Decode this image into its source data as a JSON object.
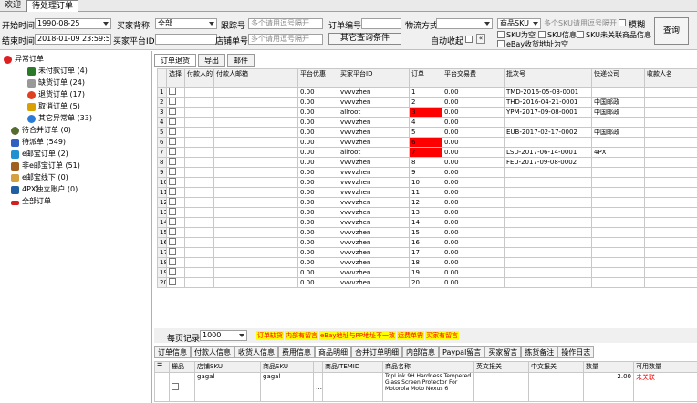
{
  "tabs": [
    "欢迎",
    "待处理订单"
  ],
  "filters": {
    "start_label": "开始时间",
    "start_value": "1990-08-25",
    "end_label": "结束时间",
    "end_value": "2018-01-09 23:59:5",
    "buyer_label": "买家背称",
    "buyer_value": "全部",
    "buyer_platform_label": "买家平台ID",
    "tracking_label": "跟踪号",
    "tracking_ph": "多个请用逗号隔开",
    "order_no_label": "订单编号",
    "logistics_label": "物流方式",
    "product_sku_select": "商品SKU",
    "sku_ph": "多个SKU请用逗号隔开",
    "fuzzy_label": "模糊",
    "store_label": "店铺单号",
    "store_ph": "多个请用逗号隔开",
    "other_query": "其它查询条件",
    "auto_collapse": "自动收起",
    "sku_empty": "SKU为空",
    "sku_multi": "SKU信息",
    "sku_unlinked": "SKU未关联商品信息",
    "ebay_addr": "eBay收货地址为空",
    "query_button": "查询"
  },
  "tree": [
    {
      "label": "异常订单",
      "color": "#e02020"
    },
    {
      "label": "未付款订单 (4)",
      "color": "#2a7a2a"
    },
    {
      "label": "缺货订单 (24)",
      "color": "#999999"
    },
    {
      "label": "退货订单 (17)",
      "color": "#e04020"
    },
    {
      "label": "取消订单 (5)",
      "color": "#d8a000"
    },
    {
      "label": "其它异常单 (33)",
      "color": "#2a7ad8"
    },
    {
      "label": "待合并订单 (0)",
      "color": "#556b2f"
    },
    {
      "label": "待派单 (549)",
      "color": "#3060c0"
    },
    {
      "label": "e邮宝订单 (2)",
      "color": "#2090d0"
    },
    {
      "label": "非e邮宝订单 (51)",
      "color": "#a06020"
    },
    {
      "label": "e邮宝线下 (0)",
      "color": "#d4a040"
    },
    {
      "label": "4PX独立账户 (0)",
      "color": "#2060a0"
    },
    {
      "label": "全部订单",
      "color": "#d02020"
    }
  ],
  "subtabs": [
    "订单退货",
    "导出",
    "邮件"
  ],
  "columns": [
    "选择",
    "付款人的",
    "付款人邮箱",
    "平台优惠",
    "买家平台ID",
    "订单",
    "平台交易费",
    "批次号",
    "快递公司",
    "收款人名"
  ],
  "rows": [
    {
      "n": "1",
      "disc": "0.00",
      "buyer": "vvvvzhen",
      "ord": "1",
      "fee": "0.00",
      "batch": "TMD-2016-05-03-0001",
      "exp": "",
      "red": false
    },
    {
      "n": "2",
      "disc": "0.00",
      "buyer": "vvvvzhen",
      "ord": "2",
      "fee": "0.00",
      "batch": "THD-2016-04-21-0001",
      "exp": "中国邮政",
      "red": false
    },
    {
      "n": "3",
      "disc": "0.00",
      "buyer": "allroot",
      "ord": "3",
      "fee": "0.00",
      "batch": "YPM-2017-09-08-0001",
      "exp": "中国邮政",
      "red": true
    },
    {
      "n": "4",
      "disc": "0.00",
      "buyer": "vvvvzhen",
      "ord": "4",
      "fee": "0.00",
      "batch": "",
      "exp": "",
      "red": false
    },
    {
      "n": "5",
      "disc": "0.00",
      "buyer": "vvvvzhen",
      "ord": "5",
      "fee": "0.00",
      "batch": "EUB-2017-02-17-0002",
      "exp": "中国邮政",
      "red": false
    },
    {
      "n": "6",
      "disc": "0.00",
      "buyer": "vvvvzhen",
      "ord": "6",
      "fee": "0.00",
      "batch": "",
      "exp": "",
      "red": true
    },
    {
      "n": "7",
      "disc": "0.00",
      "buyer": "allroot",
      "ord": "7",
      "fee": "0.00",
      "batch": "LSD-2017-06-14-0001",
      "exp": "4PX",
      "red": true
    },
    {
      "n": "8",
      "disc": "0.00",
      "buyer": "vvvvzhen",
      "ord": "8",
      "fee": "0.00",
      "batch": "FEU-2017-09-08-0002",
      "exp": "",
      "red": false
    },
    {
      "n": "9",
      "disc": "0.00",
      "buyer": "vvvvzhen",
      "ord": "9",
      "fee": "0.00",
      "batch": "",
      "exp": "",
      "red": false
    },
    {
      "n": "10",
      "disc": "0.00",
      "buyer": "vvvvzhen",
      "ord": "10",
      "fee": "0.00",
      "batch": "",
      "exp": "",
      "red": false
    },
    {
      "n": "11",
      "disc": "0.00",
      "buyer": "vvvvzhen",
      "ord": "11",
      "fee": "0.00",
      "batch": "",
      "exp": "",
      "red": false
    },
    {
      "n": "12",
      "disc": "0.00",
      "buyer": "vvvvzhen",
      "ord": "12",
      "fee": "0.00",
      "batch": "",
      "exp": "",
      "red": false
    },
    {
      "n": "13",
      "disc": "0.00",
      "buyer": "vvvvzhen",
      "ord": "13",
      "fee": "0.00",
      "batch": "",
      "exp": "",
      "red": false
    },
    {
      "n": "14",
      "disc": "0.00",
      "buyer": "vvvvzhen",
      "ord": "14",
      "fee": "0.00",
      "batch": "",
      "exp": "",
      "red": false
    },
    {
      "n": "15",
      "disc": "0.00",
      "buyer": "vvvvzhen",
      "ord": "15",
      "fee": "0.00",
      "batch": "",
      "exp": "",
      "red": false
    },
    {
      "n": "16",
      "disc": "0.00",
      "buyer": "vvvvzhen",
      "ord": "16",
      "fee": "0.00",
      "batch": "",
      "exp": "",
      "red": false
    },
    {
      "n": "17",
      "disc": "0.00",
      "buyer": "vvvvzhen",
      "ord": "17",
      "fee": "0.00",
      "batch": "",
      "exp": "",
      "red": false
    },
    {
      "n": "18",
      "disc": "0.00",
      "buyer": "vvvvzhen",
      "ord": "18",
      "fee": "0.00",
      "batch": "",
      "exp": "",
      "red": false
    },
    {
      "n": "19",
      "disc": "0.00",
      "buyer": "vvvvzhen",
      "ord": "19",
      "fee": "0.00",
      "batch": "",
      "exp": "",
      "red": false
    },
    {
      "n": "20",
      "disc": "0.00",
      "buyer": "vvvvzhen",
      "ord": "20",
      "fee": "0.00",
      "batch": "",
      "exp": "",
      "red": false
    }
  ],
  "bottom": {
    "per_page_label": "每页记录:",
    "per_page_value": "1000",
    "legend": [
      {
        "text": "订单缺货",
        "color": "#ff0000",
        "bg": "#ffff00"
      },
      {
        "text": "内部有留言",
        "color": "#ff0000",
        "bg": "#ffff00"
      },
      {
        "text": "eBay地址与PP地址不一致",
        "color": "#ff0000",
        "bg": "#ffff00"
      },
      {
        "text": "运费单需",
        "color": "#ff0000",
        "bg": "#ffff00"
      },
      {
        "text": "买家有留言",
        "color": "#ff0000",
        "bg": "#ffff00"
      }
    ]
  },
  "detail_tabs": [
    "订单信息",
    "付款人信息",
    "收货人信息",
    "费用信息",
    "商品明细",
    "合并订单明细",
    "内部信息",
    "Paypal留言",
    "买家留言",
    "拣货备注",
    "操作日志"
  ],
  "detail_columns": [
    "栅品",
    "店铺SKU",
    "商品SKU",
    "商品ITEMID",
    "商品名称",
    "英文报关",
    "中文报关",
    "数量",
    "可用数量"
  ],
  "detail_row": {
    "store_sku": "gagal",
    "product_sku": "gagal",
    "name": "TopLink 9H Hardness Tempered Glass Screen Protector For Motorola Moto Nexus 6",
    "qty": "2.00",
    "status": "未关联"
  }
}
